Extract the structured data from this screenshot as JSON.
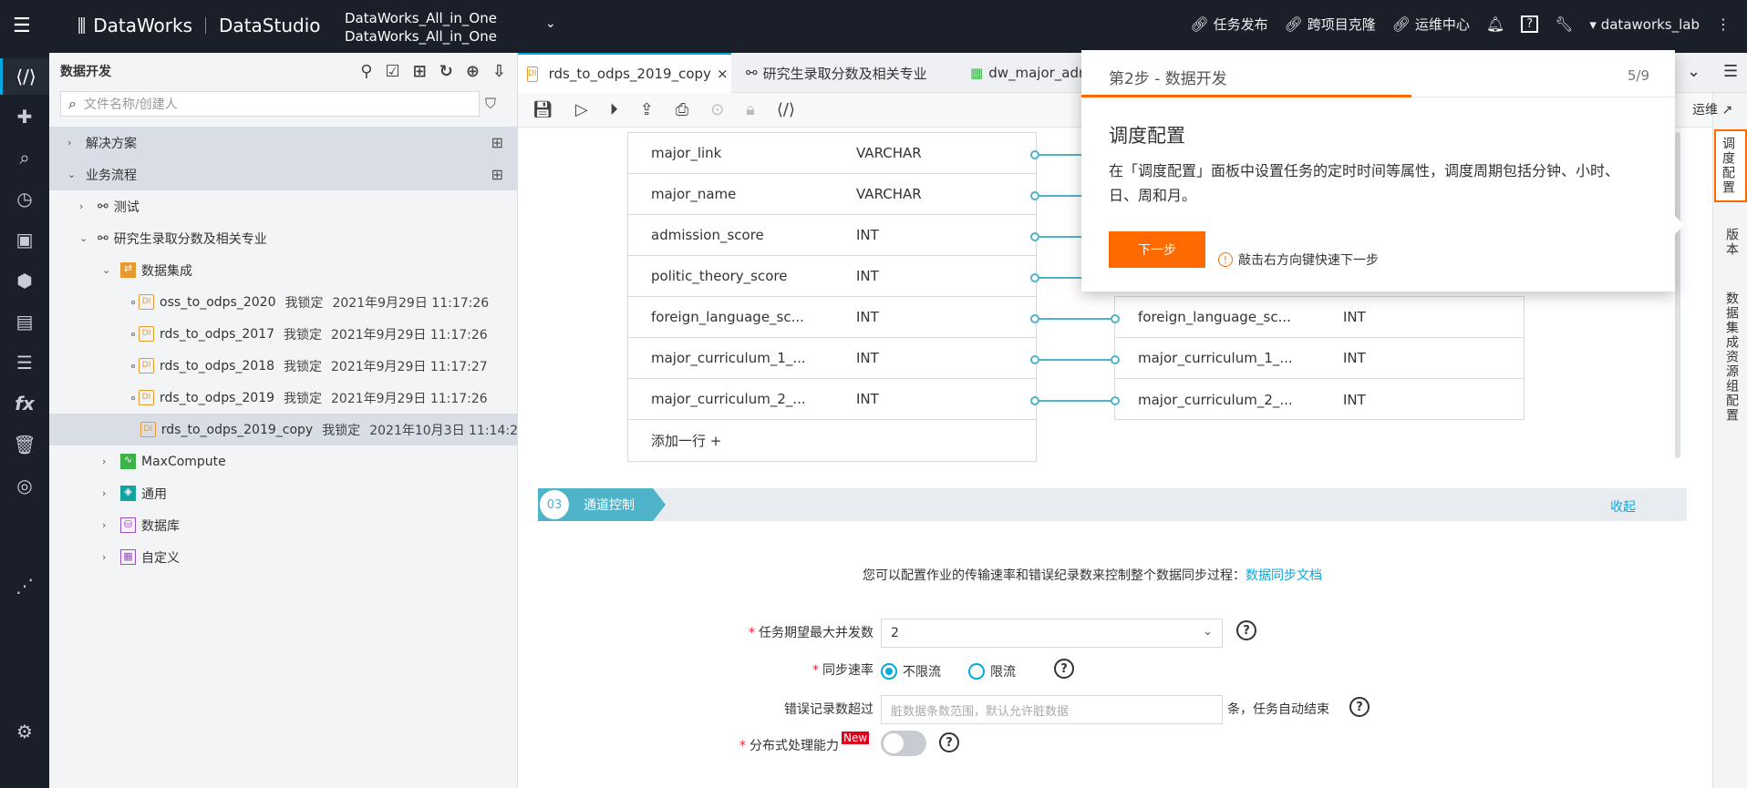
{
  "header": {
    "product": "DataWorks",
    "studio": "DataStudio",
    "workspace_line1": "DataWorks_All_in_One",
    "workspace_line2": "DataWorks_All_in_One",
    "links": [
      "任务发布",
      "跨项目克隆",
      "运维中心"
    ],
    "user": "dataworks_lab",
    "help": "?"
  },
  "left_nav": {
    "icons": [
      "datastudio-icon",
      "puzzle-icon",
      "search-icon",
      "clock-icon",
      "briefcase-icon",
      "cube-icon",
      "table-icon",
      "list-icon",
      "fx-icon",
      "trash-icon",
      "target-icon",
      "graph-icon",
      "settings-icon"
    ],
    "fx_label": "fx"
  },
  "tree": {
    "title": "数据开发",
    "search_placeholder": "文件名称/创建人",
    "solutions": "解决方案",
    "workflows": "业务流程",
    "test": "测试",
    "project": "研究生录取分数及相关专业",
    "data_integration": "数据集成",
    "files": [
      {
        "name": "oss_to_odps_2020",
        "lock": "我锁定",
        "time": "2021年9月29日 11:17:26"
      },
      {
        "name": "rds_to_odps_2017",
        "lock": "我锁定",
        "time": "2021年9月29日 11:17:26"
      },
      {
        "name": "rds_to_odps_2018",
        "lock": "我锁定",
        "time": "2021年9月29日 11:17:27"
      },
      {
        "name": "rds_to_odps_2019",
        "lock": "我锁定",
        "time": "2021年9月29日 11:17:26"
      },
      {
        "name": "rds_to_odps_2019_copy",
        "lock": "我锁定",
        "time": "2021年10月3日 11:14:2"
      }
    ],
    "maxcompute": "MaxCompute",
    "general": "通用",
    "database": "数据库",
    "custom": "自定义",
    "di_badge": "DI"
  },
  "tabs": {
    "t1": "rds_to_odps_2019_copy",
    "t1_close": "×",
    "t2": "研究生录取分数及相关专业",
    "t3": "dw_major_adm"
  },
  "mapping": {
    "left": [
      {
        "name": "major_link",
        "type": "VARCHAR"
      },
      {
        "name": "major_name",
        "type": "VARCHAR"
      },
      {
        "name": "admission_score",
        "type": "INT"
      },
      {
        "name": "politic_theory_score",
        "type": "INT"
      },
      {
        "name": "foreign_language_sc...",
        "type": "INT"
      },
      {
        "name": "major_curriculum_1_...",
        "type": "INT"
      },
      {
        "name": "major_curriculum_2_...",
        "type": "INT"
      }
    ],
    "right": [
      {
        "name": "foreign_language_sc...",
        "type": "INT"
      },
      {
        "name": "major_curriculum_1_...",
        "type": "INT"
      },
      {
        "name": "major_curriculum_2_...",
        "type": "INT"
      }
    ],
    "add_row": "添加一行 +"
  },
  "channel": {
    "num": "03",
    "title": "通道控制",
    "collapse": "收起",
    "desc": "您可以配置作业的传输速率和错误纪录数来控制整个数据同步过程：",
    "doc_link": "数据同步文档",
    "concurrency_label": "任务期望最大并发数",
    "concurrency_value": "2",
    "rate_label": "同步速率",
    "rate_opt1": "不限流",
    "rate_opt2": "限流",
    "error_label": "错误记录数超过",
    "error_placeholder": "脏数据条数范围，默认允许脏数据",
    "error_suffix": "条，任务自动结束",
    "dist_label": "分布式处理能力",
    "new_badge": "New",
    "req": "*"
  },
  "right_panel": {
    "ops": "运维 ↗",
    "items": [
      "调度配置",
      "版本",
      "数据集成资源组配置"
    ]
  },
  "tour": {
    "step": "第2步 - 数据开发",
    "count": "5/9",
    "title": "调度配置",
    "body": "在「调度配置」面板中设置任务的定时时间等属性，调度周期包括分钟、小时、日、周和月。",
    "next": "下一步",
    "tip": "敲击右方向键快速下一步",
    "tip_icon": "!"
  },
  "colors": {
    "accent": "#00a9e0",
    "orange": "#ff6a00",
    "topbar": "#1b1f2a"
  }
}
